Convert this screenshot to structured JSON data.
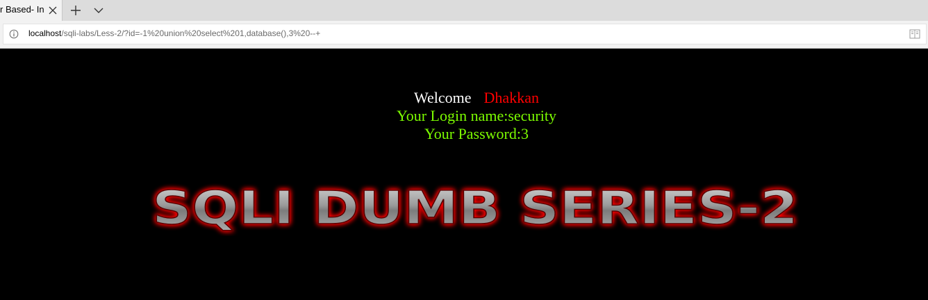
{
  "browser": {
    "tab_title": "r Based- In",
    "url_host": "localhost",
    "url_path": "/sqli-labs/Less-2/?id=-1%20union%20select%201,database(),3%20--+",
    "icons": [
      "close-icon",
      "plus-icon",
      "chevron-down-icon",
      "info-icon",
      "reading-view-icon"
    ]
  },
  "page": {
    "welcome_word": "Welcome",
    "welcome_name": "Dhakkan",
    "login_line": "Your Login name:security",
    "password_line": "Your Password:3",
    "banner_text": "SQLI DUMB SERIES-2"
  },
  "colors": {
    "background": "#000000",
    "welcome_name": "#ff0000",
    "result_text": "#7cfc00",
    "banner_glow": "#ff0000"
  }
}
